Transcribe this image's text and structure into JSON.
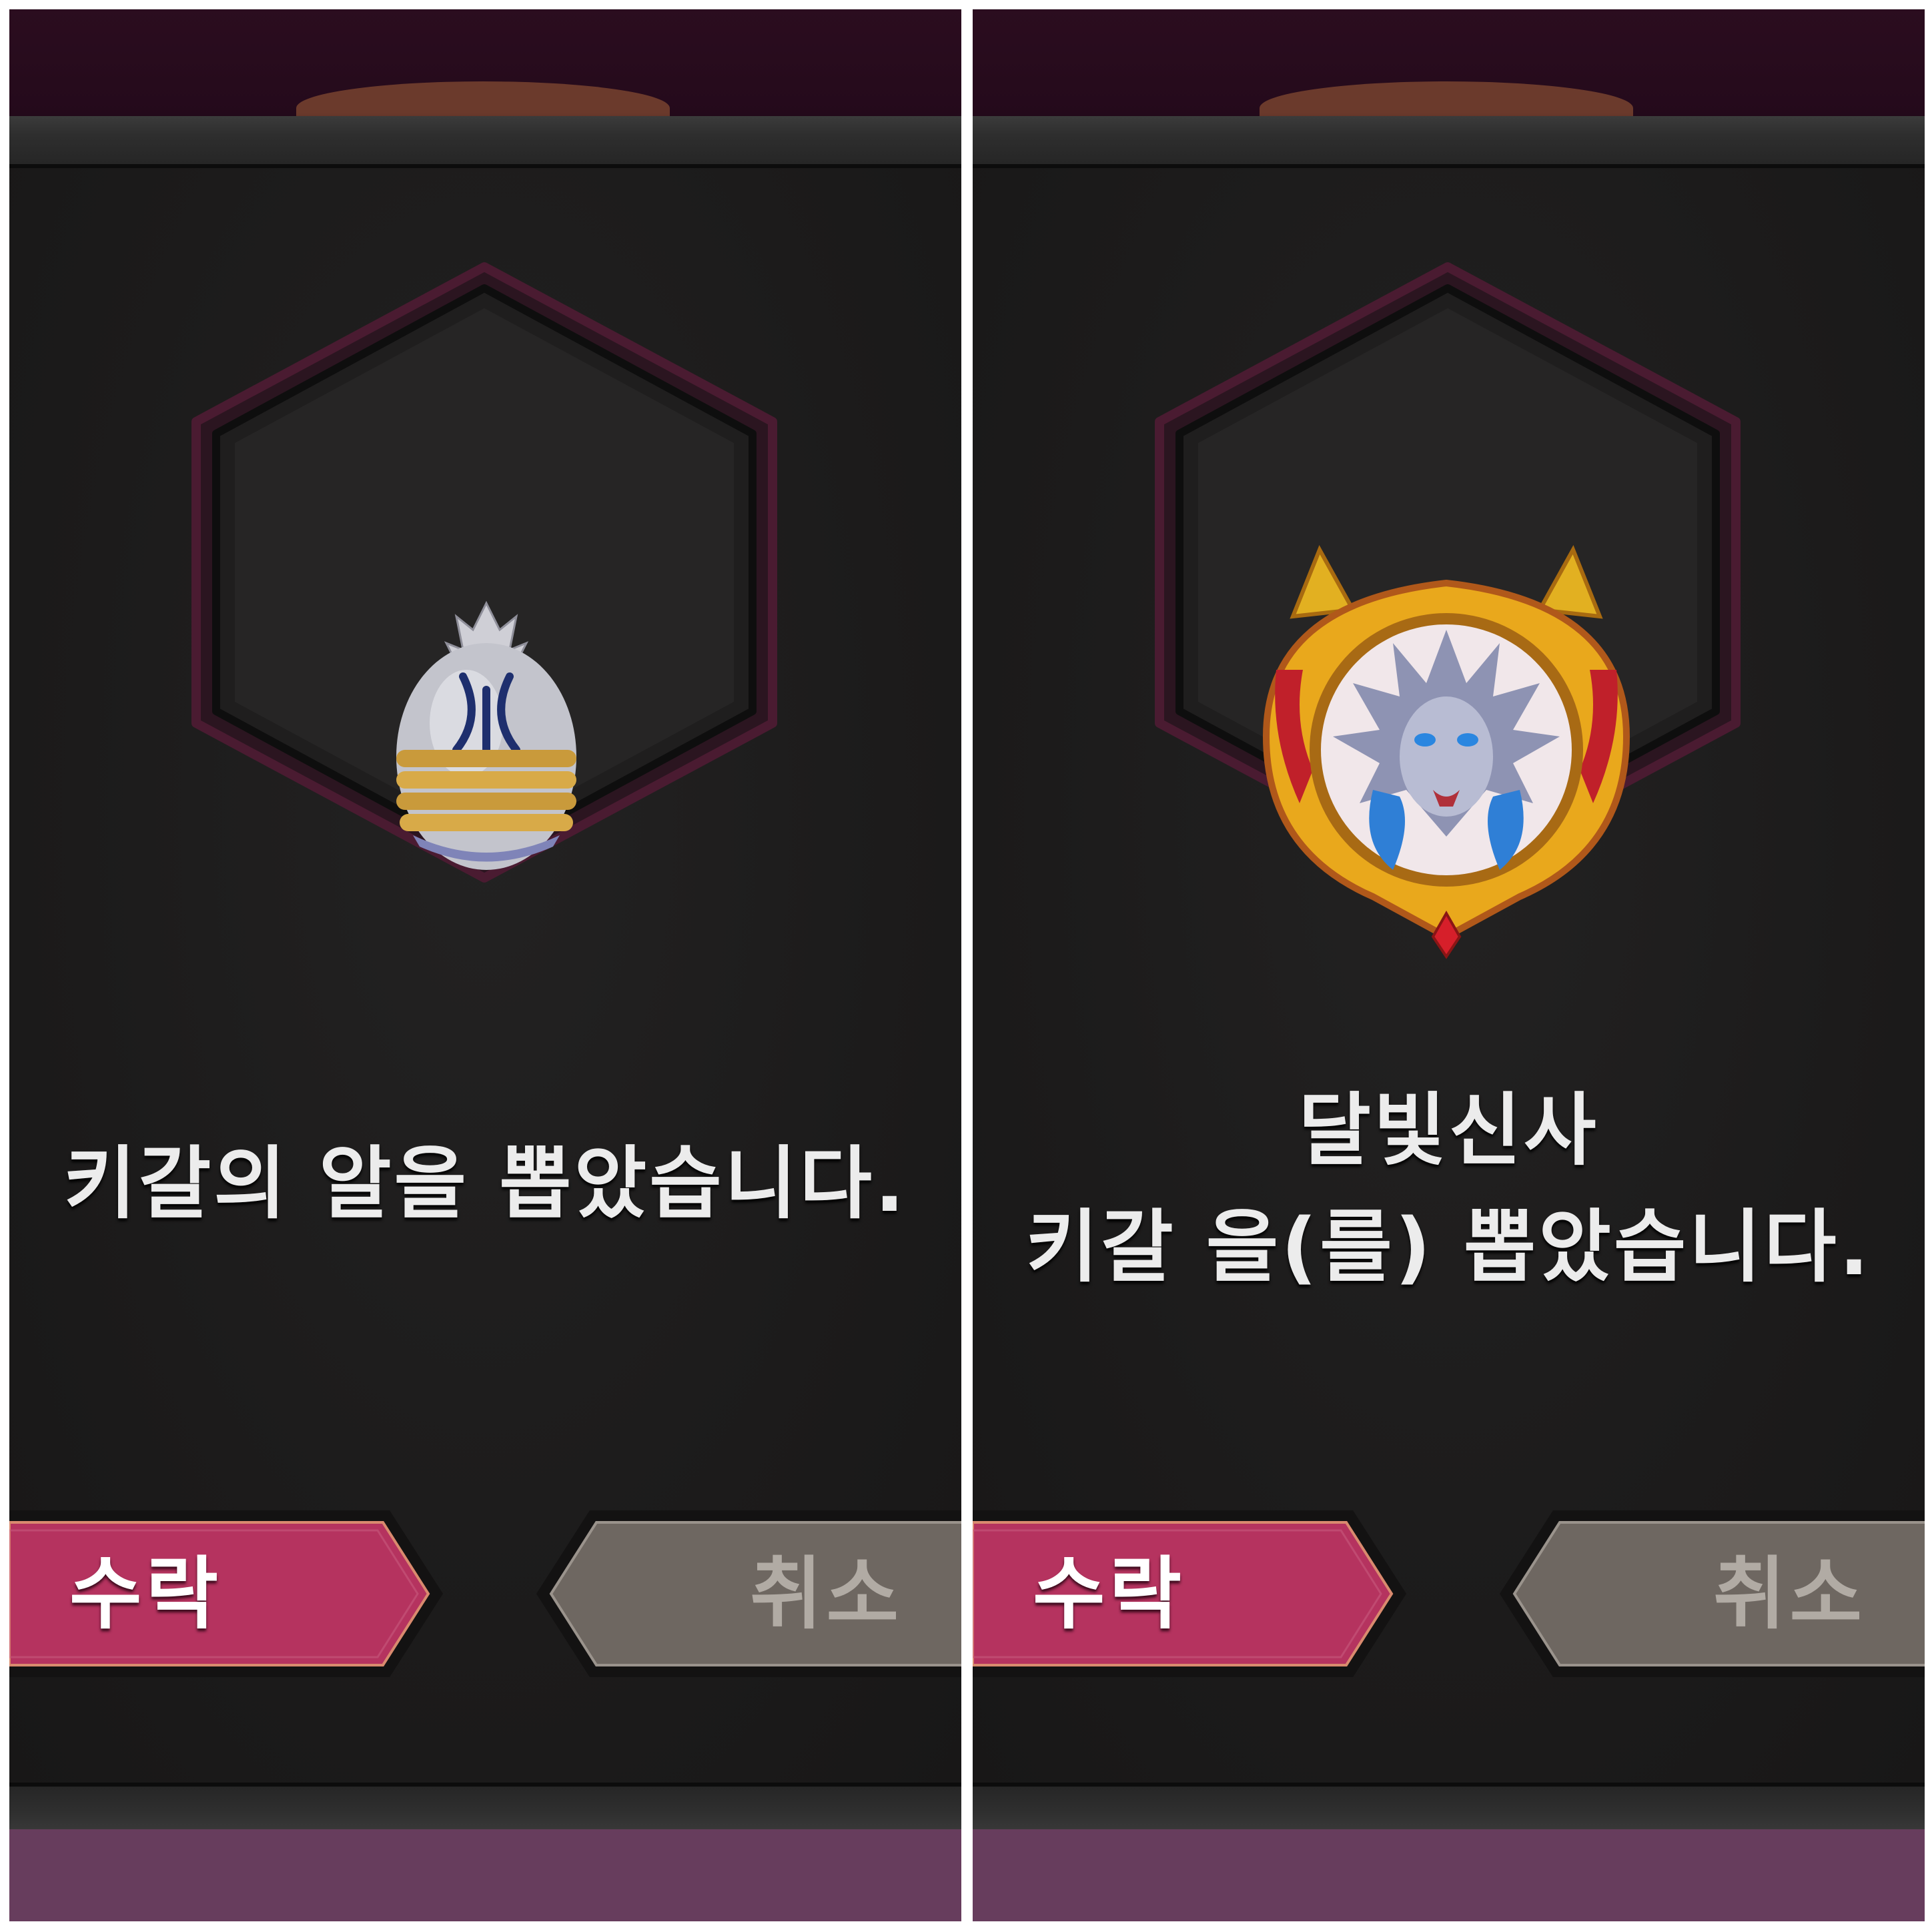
{
  "panels": [
    {
      "message_lines": [
        "키갈의 알을 뽑았습니다."
      ],
      "item": "egg-icon",
      "accept_label": "수락",
      "cancel_label": "취소"
    },
    {
      "message_lines": [
        "달빛신사",
        "키갈 을(를) 뽑았습니다."
      ],
      "item": "creature-portrait-icon",
      "accept_label": "수락",
      "cancel_label": "취소"
    }
  ],
  "colors": {
    "accept_button": "#b5335f",
    "cancel_button": "#6e6761",
    "hex_border": "#4a1b31",
    "dialog_bg": "#1b1a1a",
    "top_bar": "#2b0d1f",
    "bottom_bar": "#673d5d"
  }
}
